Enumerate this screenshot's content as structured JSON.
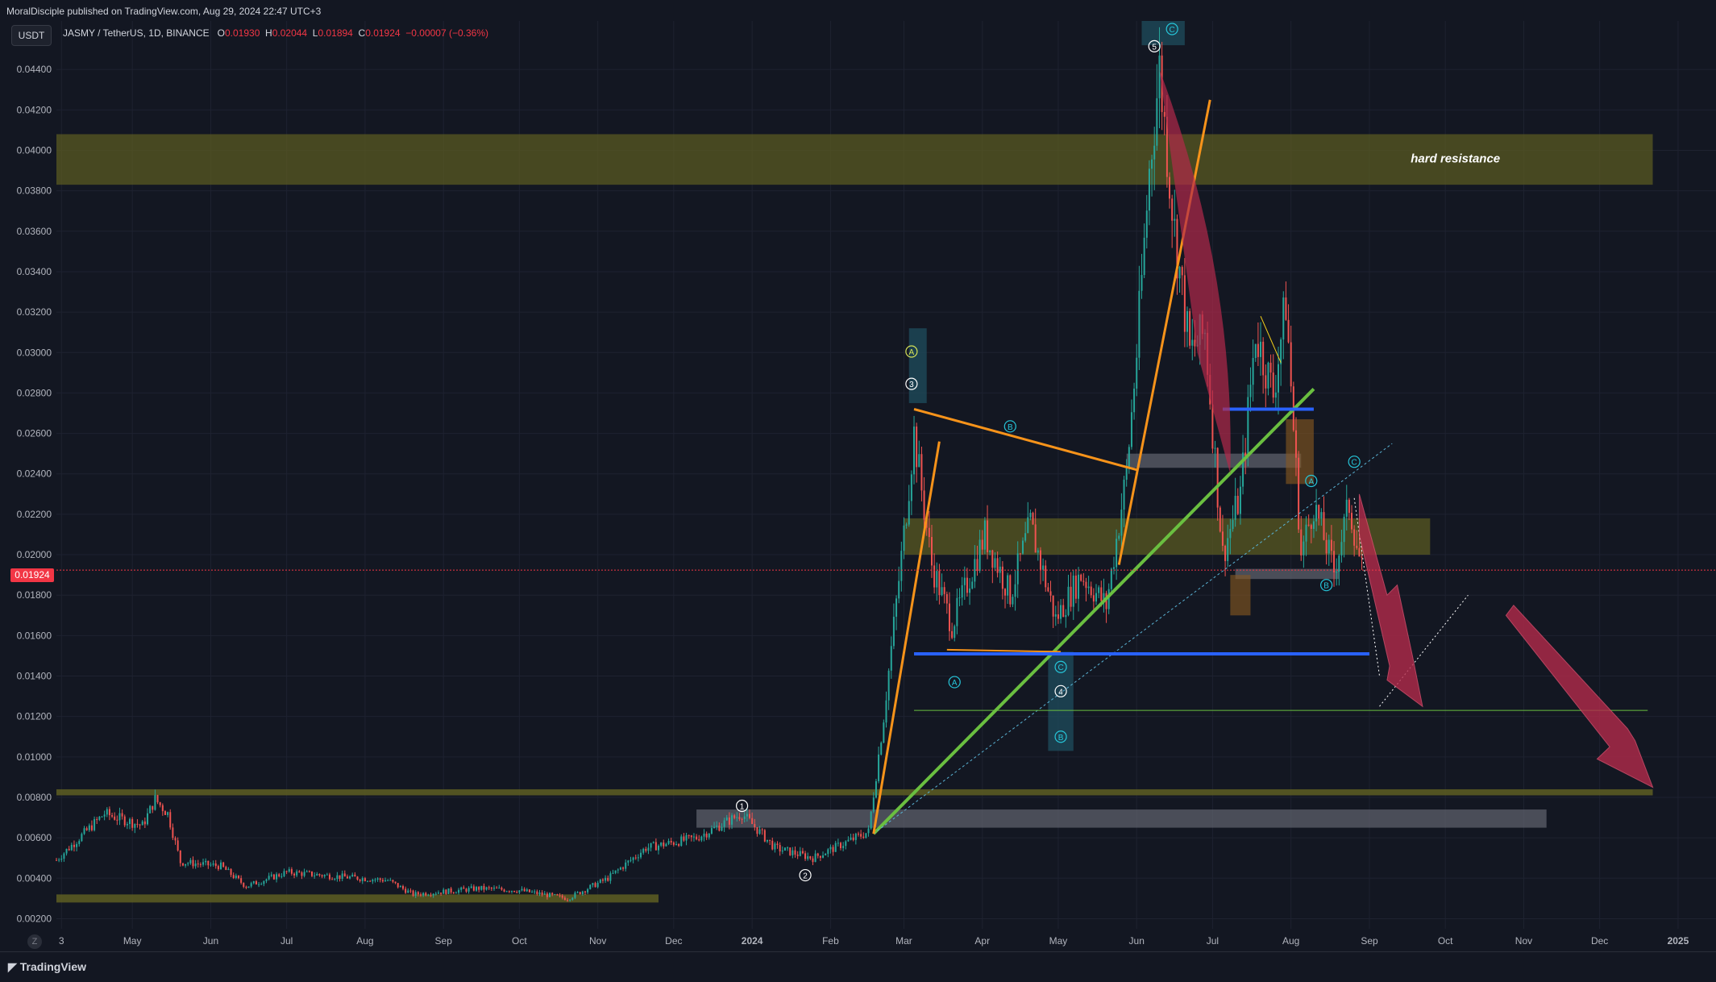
{
  "header": {
    "publisher": "MoralDisciple published on TradingView.com, Aug 29, 2024 22:47 UTC+3",
    "currency": "USDT",
    "symbol": "JASMY / TetherUS, 1D, BINANCE",
    "open_label": "O",
    "open": "0.01930",
    "high_label": "H",
    "high": "0.02044",
    "low_label": "L",
    "low": "0.01894",
    "close_label": "C",
    "close": "0.01924",
    "change": "−0.00007 (−0.36%)"
  },
  "footer": {
    "brand": "TradingView",
    "zoom_label": "Z"
  },
  "colors": {
    "background": "#131722",
    "grid": "#1e2230",
    "up": "#26a69a",
    "down": "#ef5350",
    "last_price": "#f23645",
    "zone_yellow": "#5a5a22",
    "zone_gray": "#5d606b",
    "orange": "#f7931a",
    "green": "#6abf40",
    "blue": "#2962ff",
    "crimson": "#b22a4a"
  },
  "chart_data": {
    "type": "candlestick",
    "x_tick_labels": [
      "3",
      "May",
      "Jun",
      "Jul",
      "Aug",
      "Sep",
      "Oct",
      "Nov",
      "Dec",
      "2024",
      "Feb",
      "Mar",
      "Apr",
      "May",
      "Jun",
      "Jul",
      "Aug",
      "Sep",
      "Oct",
      "Nov",
      "Dec",
      "2025"
    ],
    "x_tick_dates": [
      "2023-04-03",
      "2023-05-01",
      "2023-06-01",
      "2023-07-01",
      "2023-08-01",
      "2023-09-01",
      "2023-10-01",
      "2023-11-01",
      "2023-12-01",
      "2024-01-01",
      "2024-02-01",
      "2024-03-01",
      "2024-04-01",
      "2024-05-01",
      "2024-06-01",
      "2024-07-01",
      "2024-08-01",
      "2024-09-01",
      "2024-10-01",
      "2024-11-01",
      "2024-12-01",
      "2025-01-01"
    ],
    "y_tick_labels": [
      "0.00200",
      "0.00400",
      "0.00600",
      "0.00800",
      "0.01000",
      "0.01200",
      "0.01400",
      "0.01600",
      "0.01800",
      "0.02000",
      "0.02200",
      "0.02400",
      "0.02600",
      "0.02800",
      "0.03000",
      "0.03200",
      "0.03400",
      "0.03600",
      "0.03800",
      "0.04000",
      "0.04200",
      "0.04400"
    ],
    "ylim": [
      0.0015,
      0.0464
    ],
    "x_range": [
      "2023-04-01",
      "2025-01-16"
    ],
    "last_price": 0.01924,
    "last_price_label": "0.01924",
    "price_path": [
      [
        "2023-04-01",
        0.0049
      ],
      [
        "2023-04-20",
        0.0072
      ],
      [
        "2023-05-05",
        0.0066
      ],
      [
        "2023-05-10",
        0.0079
      ],
      [
        "2023-05-15",
        0.0072
      ],
      [
        "2023-05-20",
        0.0048
      ],
      [
        "2023-06-05",
        0.0046
      ],
      [
        "2023-06-15",
        0.0036
      ],
      [
        "2023-07-01",
        0.0043
      ],
      [
        "2023-07-20",
        0.0041
      ],
      [
        "2023-08-10",
        0.0039
      ],
      [
        "2023-08-20",
        0.0032
      ],
      [
        "2023-09-15",
        0.0035
      ],
      [
        "2023-10-01",
        0.0034
      ],
      [
        "2023-10-20",
        0.003
      ],
      [
        "2023-11-05",
        0.004
      ],
      [
        "2023-11-20",
        0.0055
      ],
      [
        "2023-12-10",
        0.006
      ],
      [
        "2023-12-28",
        0.0072
      ],
      [
        "2024-01-10",
        0.0055
      ],
      [
        "2024-01-25",
        0.005
      ],
      [
        "2024-02-16",
        0.0063
      ],
      [
        "2024-02-22",
        0.012
      ],
      [
        "2024-03-01",
        0.021
      ],
      [
        "2024-03-05",
        0.026
      ],
      [
        "2024-03-12",
        0.0195
      ],
      [
        "2024-03-20",
        0.0165
      ],
      [
        "2024-04-02",
        0.021
      ],
      [
        "2024-04-12",
        0.018
      ],
      [
        "2024-04-20",
        0.0215
      ],
      [
        "2024-04-30",
        0.0168
      ],
      [
        "2024-05-10",
        0.019
      ],
      [
        "2024-05-20",
        0.0175
      ],
      [
        "2024-05-28",
        0.024
      ],
      [
        "2024-06-01",
        0.03
      ],
      [
        "2024-06-06",
        0.039
      ],
      [
        "2024-06-10",
        0.044
      ],
      [
        "2024-06-16",
        0.036
      ],
      [
        "2024-06-22",
        0.03
      ],
      [
        "2024-06-28",
        0.031
      ],
      [
        "2024-07-05",
        0.02
      ],
      [
        "2024-07-12",
        0.023
      ],
      [
        "2024-07-18",
        0.031
      ],
      [
        "2024-07-25",
        0.028
      ],
      [
        "2024-07-30",
        0.0325
      ],
      [
        "2024-08-05",
        0.02
      ],
      [
        "2024-08-10",
        0.0225
      ],
      [
        "2024-08-18",
        0.0192
      ],
      [
        "2024-08-24",
        0.0225
      ],
      [
        "2024-08-29",
        0.0192
      ]
    ]
  },
  "annotations": {
    "hard_resistance": "hard resistance",
    "wave_labels": [
      {
        "text": "1",
        "date": "2023-12-28",
        "price": 0.00758
      },
      {
        "text": "2",
        "date": "2024-01-22",
        "price": 0.00415
      },
      {
        "text": "3",
        "date": "2024-03-04",
        "price": 0.02845
      },
      {
        "text": "A",
        "date": "2024-03-04",
        "price": 0.03005
      },
      {
        "text": "B",
        "date": "2024-04-12",
        "price": 0.02635
      },
      {
        "text": "A",
        "date": "2024-03-21",
        "price": 0.0137
      },
      {
        "text": "C",
        "date": "2024-05-02",
        "price": 0.01445
      },
      {
        "text": "4",
        "date": "2024-05-02",
        "price": 0.01325
      },
      {
        "text": "B",
        "date": "2024-05-02",
        "price": 0.011
      },
      {
        "text": "5",
        "date": "2024-06-08",
        "price": 0.04515
      },
      {
        "text": "C",
        "date": "2024-06-15",
        "price": 0.046
      },
      {
        "text": "A",
        "date": "2024-08-09",
        "price": 0.02365
      },
      {
        "text": "B",
        "date": "2024-08-15",
        "price": 0.0185
      },
      {
        "text": "C",
        "date": "2024-08-26",
        "price": 0.0246
      }
    ]
  }
}
